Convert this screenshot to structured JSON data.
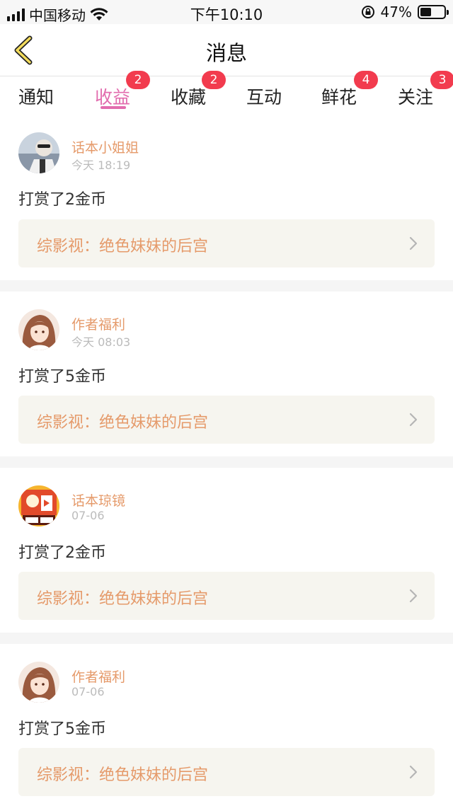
{
  "status_bar": {
    "carrier": "中国移动",
    "time": "下午10:10",
    "battery": "47%",
    "battery_level": 0.47
  },
  "nav": {
    "title": "消息",
    "back_icon": "chevron-left-icon"
  },
  "tabs": [
    {
      "label": "通知",
      "badge": ""
    },
    {
      "label": "收益",
      "badge": "2"
    },
    {
      "label": "收藏",
      "badge": "2"
    },
    {
      "label": "互动",
      "badge": ""
    },
    {
      "label": "鲜花",
      "badge": "4"
    },
    {
      "label": "关注",
      "badge": "3"
    }
  ],
  "active_tab": "收益",
  "colors": {
    "accent": "#e26cae",
    "badge": "#f23b4e",
    "name": "#e59a6a",
    "link_bg": "#f6f5ef"
  },
  "messages": [
    {
      "name": "话本小姐姐",
      "time": "今天 18:19",
      "action": "打赏了2金币",
      "book": "综影视：绝色妹妹的后宫"
    },
    {
      "name": "作者福利",
      "time": "今天 08:03",
      "action": "打赏了5金币",
      "book": "综影视：绝色妹妹的后宫"
    },
    {
      "name": "话本琼镜",
      "time": "07-06",
      "action": "打赏了2金币",
      "book": "综影视：绝色妹妹的后宫"
    },
    {
      "name": "作者福利",
      "time": "07-06",
      "action": "打赏了5金币",
      "book": "综影视：绝色妹妹的后宫"
    }
  ]
}
